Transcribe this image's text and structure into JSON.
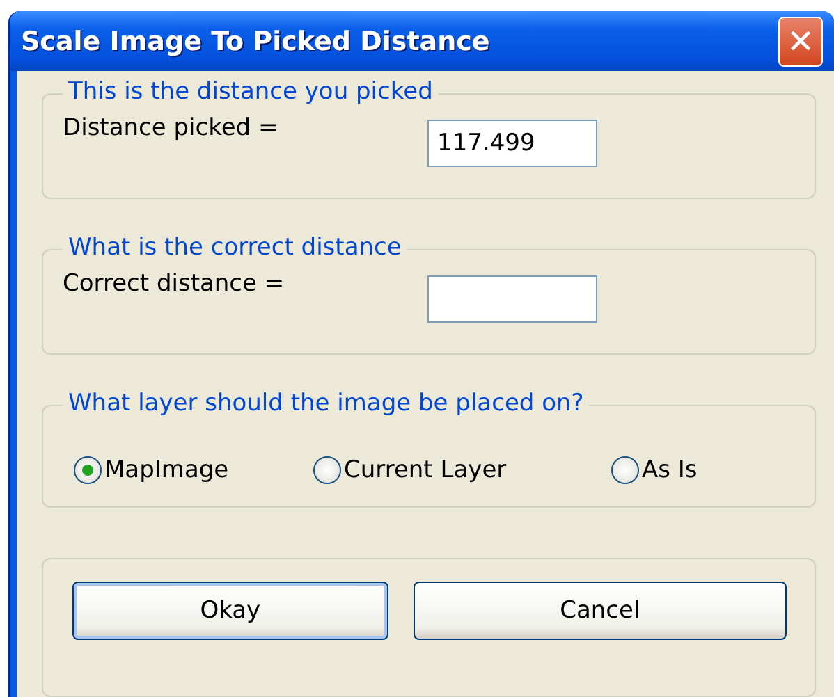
{
  "window": {
    "title": "Scale Image To Picked Distance",
    "close": "✕"
  },
  "groups": [
    {
      "kind": "field",
      "legend": "This is the distance you picked",
      "label": "Distance picked =",
      "value": "117.499"
    },
    {
      "kind": "field",
      "legend": "What is the correct distance",
      "label": "Correct distance ="
    },
    {
      "kind": "radios",
      "legend": "What layer should the image be placed on?",
      "options": [
        {
          "label": "MapImage",
          "selected": true
        },
        {
          "label": "Current Layer",
          "selected": false
        },
        {
          "label": "As Is",
          "selected": false
        }
      ]
    },
    {
      "kind": "buttons",
      "buttons": [
        {
          "label": "Okay",
          "default": true
        },
        {
          "label": "Cancel",
          "default": false
        }
      ]
    }
  ]
}
